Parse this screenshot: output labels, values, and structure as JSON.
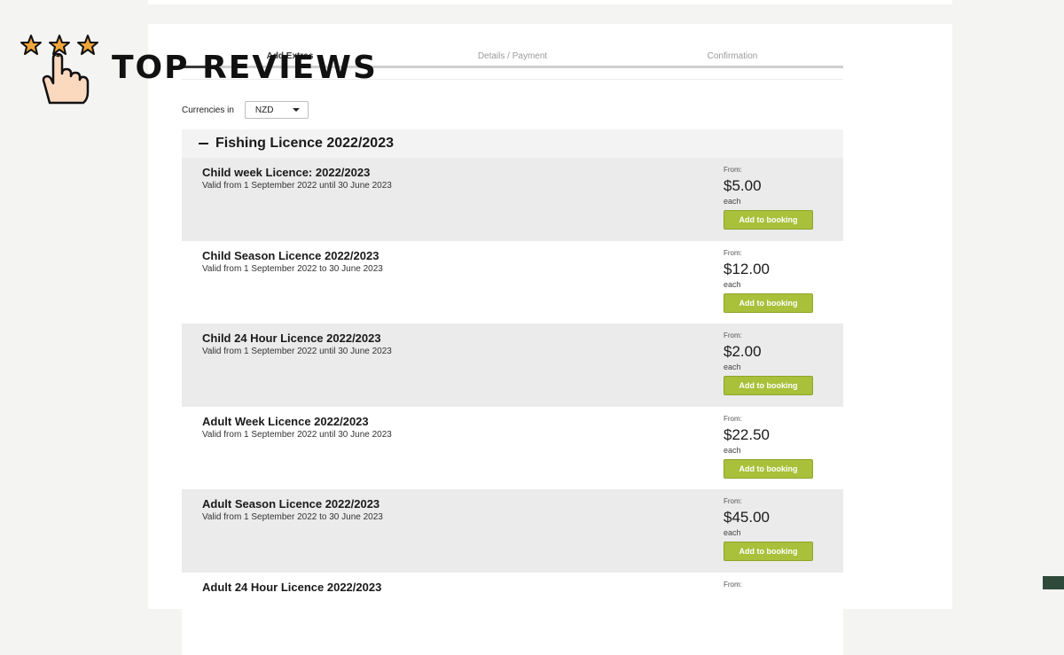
{
  "watermark": {
    "text": "TOP REVIEWS",
    "star_color": "#f2a63a",
    "icon": "pointing-hand-icon"
  },
  "steps": {
    "items": [
      {
        "label": "Add Extras",
        "active": true
      },
      {
        "label": "Details / Payment",
        "active": false
      },
      {
        "label": "Confirmation",
        "active": false
      }
    ],
    "progress": 0.05
  },
  "currency": {
    "label": "Currencies in",
    "selected": "NZD"
  },
  "section": {
    "title": "Fishing Licence 2022/2023",
    "items": [
      {
        "name": "Child week Licence: 2022/2023",
        "valid": "Valid from 1 September 2022 until 30 June 2023",
        "from": "From:",
        "price": "$5.00",
        "each": "each",
        "button": "Add to booking"
      },
      {
        "name": "Child Season Licence 2022/2023",
        "valid": "Valid from 1 September 2022 to 30 June 2023",
        "from": "From:",
        "price": "$12.00",
        "each": "each",
        "button": "Add to booking"
      },
      {
        "name": "Child 24 Hour Licence 2022/2023",
        "valid": "Valid from 1 September 2022 until 30 June 2023",
        "from": "From:",
        "price": "$2.00",
        "each": "each",
        "button": "Add to booking"
      },
      {
        "name": "Adult Week Licence 2022/2023",
        "valid": "Valid from 1 September 2022 until 30 June 2023",
        "from": "From:",
        "price": "$22.50",
        "each": "each",
        "button": "Add to booking"
      },
      {
        "name": "Adult Season Licence 2022/2023",
        "valid": "Valid from 1 September 2022 to 30 June 2023",
        "from": "From:",
        "price": "$45.00",
        "each": "each",
        "button": "Add to booking"
      },
      {
        "name": "Adult 24 Hour Licence 2022/2023",
        "valid": "",
        "from": "From:",
        "price": "",
        "each": "",
        "button": ""
      }
    ]
  },
  "colors": {
    "button_green": "#a8c03a",
    "row_shade": "#ebebeb",
    "page_bg": "#f4f4f2"
  }
}
